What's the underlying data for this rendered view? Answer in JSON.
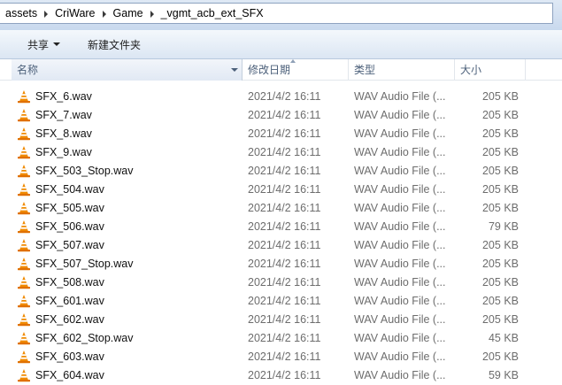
{
  "breadcrumb": [
    "assets",
    "CriWare",
    "Game",
    "_vgmt_acb_ext_SFX"
  ],
  "toolbar": {
    "share_label": "共享",
    "new_folder_label": "新建文件夹"
  },
  "columns": {
    "name": "名称",
    "date": "修改日期",
    "type": "类型",
    "size": "大小"
  },
  "icon_names": {
    "file": "vlc-cone-icon"
  },
  "colors": {
    "accent": "#f08a00",
    "header_text": "#4c607a"
  },
  "files": [
    {
      "name": "SFX_6.wav",
      "date": "2021/4/2 16:11",
      "type": "WAV Audio File (...",
      "size": "205 KB"
    },
    {
      "name": "SFX_7.wav",
      "date": "2021/4/2 16:11",
      "type": "WAV Audio File (...",
      "size": "205 KB"
    },
    {
      "name": "SFX_8.wav",
      "date": "2021/4/2 16:11",
      "type": "WAV Audio File (...",
      "size": "205 KB"
    },
    {
      "name": "SFX_9.wav",
      "date": "2021/4/2 16:11",
      "type": "WAV Audio File (...",
      "size": "205 KB"
    },
    {
      "name": "SFX_503_Stop.wav",
      "date": "2021/4/2 16:11",
      "type": "WAV Audio File (...",
      "size": "205 KB"
    },
    {
      "name": "SFX_504.wav",
      "date": "2021/4/2 16:11",
      "type": "WAV Audio File (...",
      "size": "205 KB"
    },
    {
      "name": "SFX_505.wav",
      "date": "2021/4/2 16:11",
      "type": "WAV Audio File (...",
      "size": "205 KB"
    },
    {
      "name": "SFX_506.wav",
      "date": "2021/4/2 16:11",
      "type": "WAV Audio File (...",
      "size": "79 KB"
    },
    {
      "name": "SFX_507.wav",
      "date": "2021/4/2 16:11",
      "type": "WAV Audio File (...",
      "size": "205 KB"
    },
    {
      "name": "SFX_507_Stop.wav",
      "date": "2021/4/2 16:11",
      "type": "WAV Audio File (...",
      "size": "205 KB"
    },
    {
      "name": "SFX_508.wav",
      "date": "2021/4/2 16:11",
      "type": "WAV Audio File (...",
      "size": "205 KB"
    },
    {
      "name": "SFX_601.wav",
      "date": "2021/4/2 16:11",
      "type": "WAV Audio File (...",
      "size": "205 KB"
    },
    {
      "name": "SFX_602.wav",
      "date": "2021/4/2 16:11",
      "type": "WAV Audio File (...",
      "size": "205 KB"
    },
    {
      "name": "SFX_602_Stop.wav",
      "date": "2021/4/2 16:11",
      "type": "WAV Audio File (...",
      "size": "45 KB"
    },
    {
      "name": "SFX_603.wav",
      "date": "2021/4/2 16:11",
      "type": "WAV Audio File (...",
      "size": "205 KB"
    },
    {
      "name": "SFX_604.wav",
      "date": "2021/4/2 16:11",
      "type": "WAV Audio File (...",
      "size": "59 KB"
    }
  ]
}
